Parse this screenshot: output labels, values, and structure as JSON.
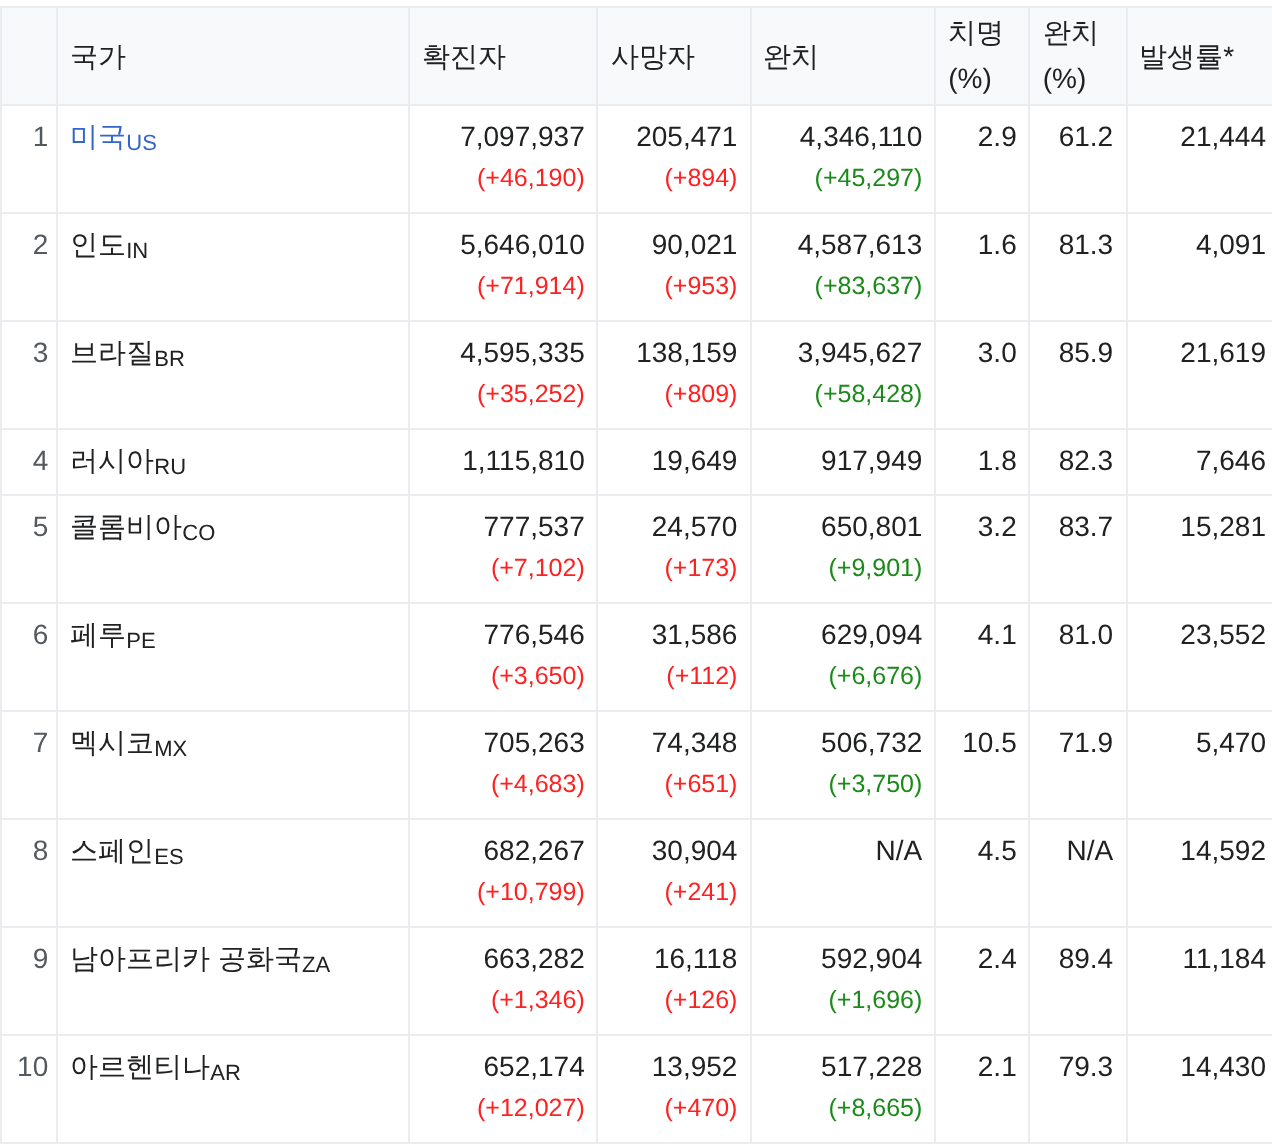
{
  "table": {
    "columns": [
      "국가",
      "확진자",
      "사망자",
      "완치",
      "치명 (%)",
      "완치 (%)",
      "발생률*"
    ],
    "rows": [
      {
        "rank": "1",
        "country": "미국",
        "code": "US",
        "link": true,
        "confirmed": "7,097,937",
        "confirmed_delta": "(+46,190)",
        "deaths": "205,471",
        "deaths_delta": "(+894)",
        "recovered": "4,346,110",
        "recovered_delta": "(+45,297)",
        "fatality": "2.9",
        "recovery": "61.2",
        "incidence": "21,444"
      },
      {
        "rank": "2",
        "country": "인도",
        "code": "IN",
        "link": false,
        "confirmed": "5,646,010",
        "confirmed_delta": "(+71,914)",
        "deaths": "90,021",
        "deaths_delta": "(+953)",
        "recovered": "4,587,613",
        "recovered_delta": "(+83,637)",
        "fatality": "1.6",
        "recovery": "81.3",
        "incidence": "4,091"
      },
      {
        "rank": "3",
        "country": "브라질",
        "code": "BR",
        "link": false,
        "confirmed": "4,595,335",
        "confirmed_delta": "(+35,252)",
        "deaths": "138,159",
        "deaths_delta": "(+809)",
        "recovered": "3,945,627",
        "recovered_delta": "(+58,428)",
        "fatality": "3.0",
        "recovery": "85.9",
        "incidence": "21,619"
      },
      {
        "rank": "4",
        "country": "러시아",
        "code": "RU",
        "link": false,
        "confirmed": "1,115,810",
        "deaths": "19,649",
        "recovered": "917,949",
        "fatality": "1.8",
        "recovery": "82.3",
        "incidence": "7,646"
      },
      {
        "rank": "5",
        "country": "콜롬비아",
        "code": "CO",
        "link": false,
        "confirmed": "777,537",
        "confirmed_delta": "(+7,102)",
        "deaths": "24,570",
        "deaths_delta": "(+173)",
        "recovered": "650,801",
        "recovered_delta": "(+9,901)",
        "fatality": "3.2",
        "recovery": "83.7",
        "incidence": "15,281"
      },
      {
        "rank": "6",
        "country": "페루",
        "code": "PE",
        "link": false,
        "confirmed": "776,546",
        "confirmed_delta": "(+3,650)",
        "deaths": "31,586",
        "deaths_delta": "(+112)",
        "recovered": "629,094",
        "recovered_delta": "(+6,676)",
        "fatality": "4.1",
        "recovery": "81.0",
        "incidence": "23,552"
      },
      {
        "rank": "7",
        "country": "멕시코",
        "code": "MX",
        "link": false,
        "confirmed": "705,263",
        "confirmed_delta": "(+4,683)",
        "deaths": "74,348",
        "deaths_delta": "(+651)",
        "recovered": "506,732",
        "recovered_delta": "(+3,750)",
        "fatality": "10.5",
        "recovery": "71.9",
        "incidence": "5,470"
      },
      {
        "rank": "8",
        "country": "스페인",
        "code": "ES",
        "link": false,
        "confirmed": "682,267",
        "confirmed_delta": "(+10,799)",
        "deaths": "30,904",
        "deaths_delta": "(+241)",
        "recovered": "N/A",
        "fatality": "4.5",
        "recovery": "N/A",
        "incidence": "14,592"
      },
      {
        "rank": "9",
        "country": "남아프리카 공화국",
        "code": "ZA",
        "link": false,
        "confirmed": "663,282",
        "confirmed_delta": "(+1,346)",
        "deaths": "16,118",
        "deaths_delta": "(+126)",
        "recovered": "592,904",
        "recovered_delta": "(+1,696)",
        "fatality": "2.4",
        "recovery": "89.4",
        "incidence": "11,184"
      },
      {
        "rank": "10",
        "country": "아르헨티나",
        "code": "AR",
        "link": false,
        "confirmed": "652,174",
        "confirmed_delta": "(+12,027)",
        "deaths": "13,952",
        "deaths_delta": "(+470)",
        "recovered": "517,228",
        "recovered_delta": "(+8,665)",
        "fatality": "2.1",
        "recovery": "79.3",
        "incidence": "14,430"
      }
    ]
  }
}
